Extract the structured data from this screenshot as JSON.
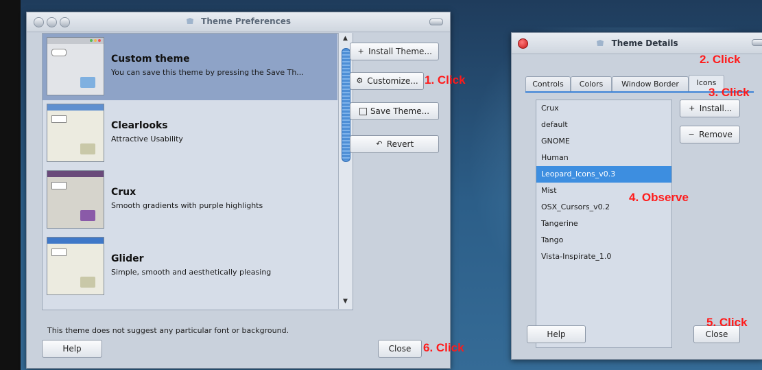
{
  "theme_preferences": {
    "title": "Theme Preferences",
    "themes": [
      {
        "name": "Custom theme",
        "description": "You can save this theme by pressing the Save Th...",
        "selected": true
      },
      {
        "name": "Clearlooks",
        "description": "Attractive Usability",
        "selected": false
      },
      {
        "name": "Crux",
        "description": "Smooth gradients with purple highlights",
        "selected": false
      },
      {
        "name": "Glider",
        "description": "Simple, smooth and aesthetically pleasing",
        "selected": false
      }
    ],
    "buttons": {
      "install": "Install Theme...",
      "customize": "Customize...",
      "save": "Save Theme...",
      "revert": "Revert",
      "help": "Help",
      "close": "Close"
    },
    "hint": "This theme does not suggest any particular font or background."
  },
  "theme_details": {
    "title": "Theme Details",
    "tabs": [
      "Controls",
      "Colors",
      "Window Border",
      "Icons"
    ],
    "active_tab": "Icons",
    "icon_themes": [
      "Crux",
      "default",
      "GNOME",
      "Human",
      "Leopard_Icons_v0.3",
      "Mist",
      "OSX_Cursors_v0.2",
      "Tangerine",
      "Tango",
      "Vista-Inspirate_1.0"
    ],
    "selected_icon_theme": "Leopard_Icons_v0.3",
    "buttons": {
      "install": "Install...",
      "remove": "Remove",
      "help": "Help",
      "close": "Close"
    }
  },
  "annotations": {
    "step1": "1. Click",
    "step2": "2. Click",
    "step3": "3. Click",
    "step4": "4. Observe",
    "step5": "5. Click",
    "step6": "6. Click"
  },
  "colors": {
    "annotation": "#ff1a1a",
    "selection_list": "#8ea3c7",
    "selection_icon": "#3d8ee0"
  }
}
